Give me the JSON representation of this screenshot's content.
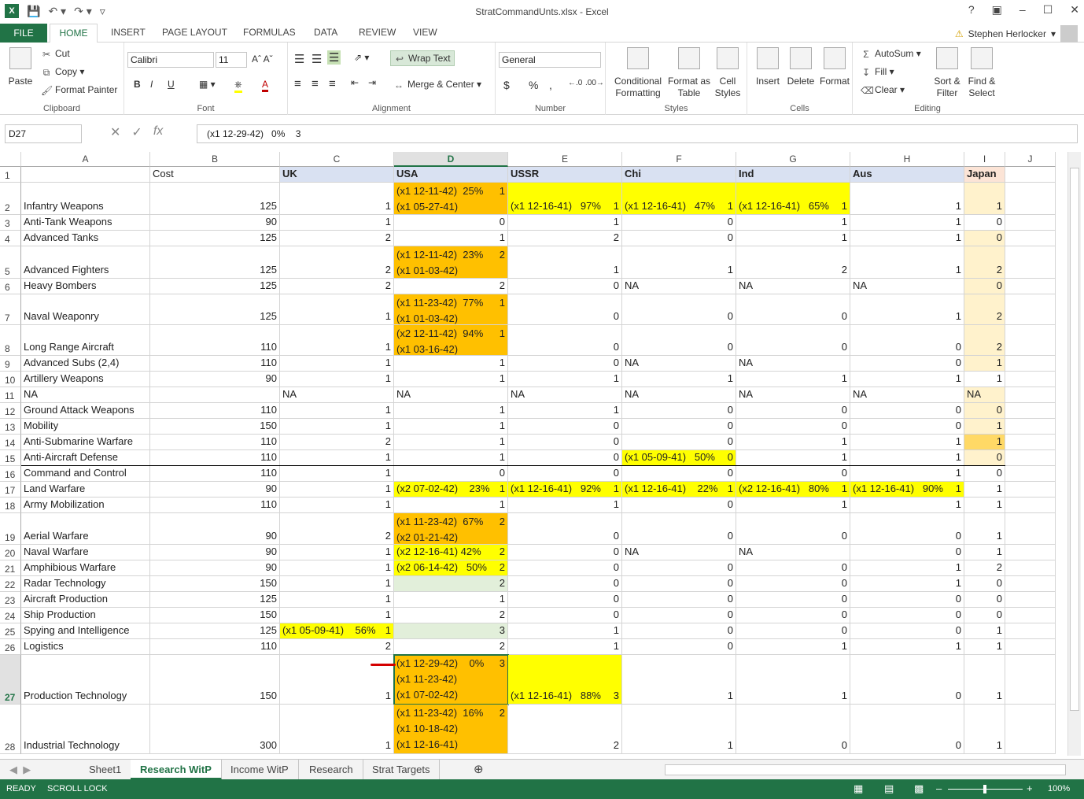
{
  "window": {
    "title": "StratCommandUnts.xlsx - Excel",
    "help": "?",
    "controls": [
      "restore-ribbon",
      "minimize",
      "maximize",
      "close"
    ]
  },
  "ribbon_tabs": [
    "FILE",
    "HOME",
    "INSERT",
    "PAGE LAYOUT",
    "FORMULAS",
    "DATA",
    "REVIEW",
    "VIEW"
  ],
  "user": {
    "name": "Stephen Herlocker"
  },
  "clipboard": {
    "paste": "Paste",
    "cut": "Cut",
    "copy": "Copy",
    "format_painter": "Format Painter",
    "label": "Clipboard"
  },
  "font": {
    "name": "Calibri",
    "size": "11",
    "label": "Font",
    "bold": "B",
    "italic": "I",
    "underline": "U"
  },
  "alignment": {
    "wrap_text": "Wrap Text",
    "merge_center": "Merge & Center",
    "label": "Alignment"
  },
  "number": {
    "format": "General",
    "currency": "$",
    "percent": "%",
    "comma": ",",
    "label": "Number"
  },
  "styles": {
    "conditional": [
      "Conditional",
      "Formatting"
    ],
    "format_table": [
      "Format as",
      "Table"
    ],
    "cell_styles": [
      "Cell",
      "Styles"
    ],
    "label": "Styles"
  },
  "cells": {
    "insert": "Insert",
    "delete": "Delete",
    "format": "Format",
    "label": "Cells"
  },
  "editing": {
    "autosum": "AutoSum",
    "fill": "Fill",
    "clear": "Clear",
    "sort": [
      "Sort &",
      "Filter"
    ],
    "find": [
      "Find &",
      "Select"
    ],
    "label": "Editing"
  },
  "formula_bar": {
    "name_box": "D27",
    "value": "(x1 12-29-42)   0%    3"
  },
  "columns": [
    "A",
    "B",
    "C",
    "D",
    "E",
    "F",
    "G",
    "H",
    "I",
    "J"
  ],
  "active_cell": "D27",
  "rows": [
    {
      "n": "1",
      "h": 20,
      "A": "",
      "B": "Cost",
      "C": "UK",
      "D": "USA",
      "E": "USSR",
      "F": "Chi",
      "G": "Ind",
      "H": "Aus",
      "I": "Japan",
      "J": ""
    },
    {
      "n": "2",
      "h": 41,
      "A": "Infantry Weapons",
      "B": "125",
      "C": "1",
      "D": [
        [
          "(x1 12-11-42)  25%",
          "1"
        ],
        [
          "(x1 05-27-41)",
          ""
        ]
      ],
      "E": [
        [
          "(x1 12-16-41)   97%",
          "1"
        ]
      ],
      "F": [
        [
          "(x1 12-16-41)   47%",
          "1"
        ]
      ],
      "G": [
        [
          "(x1 12-16-41)   65%",
          "1"
        ]
      ],
      "H": "1",
      "I": "1"
    },
    {
      "n": "3",
      "h": 20,
      "A": "Anti-Tank Weapons",
      "B": "90",
      "C": "1",
      "D": "0",
      "E": "1",
      "F": "0",
      "G": "1",
      "H": "1",
      "I": "0"
    },
    {
      "n": "4",
      "h": 20,
      "A": "Advanced Tanks",
      "B": "125",
      "C": "2",
      "D": "1",
      "E": "2",
      "F": "0",
      "G": "1",
      "H": "1",
      "I": "0"
    },
    {
      "n": "5",
      "h": 41,
      "A": "Advanced Fighters",
      "B": "125",
      "C": "2",
      "D": [
        [
          "(x1 12-11-42)  23%",
          "2"
        ],
        [
          "(x1 01-03-42)",
          ""
        ]
      ],
      "E": "1",
      "F": "1",
      "G": "2",
      "H": "1",
      "I": "2"
    },
    {
      "n": "6",
      "h": 20,
      "A": "Heavy Bombers",
      "B": "125",
      "C": "2",
      "D": "2",
      "E": "0",
      "F": "NA",
      "G": "NA",
      "H": "NA",
      "I": "0"
    },
    {
      "n": "7",
      "h": 39,
      "A": "Naval Weaponry",
      "B": "125",
      "C": "1",
      "D": [
        [
          "(x1 11-23-42)  77%",
          "1"
        ],
        [
          "(x1 01-03-42)",
          ""
        ]
      ],
      "E": "0",
      "F": "0",
      "G": "0",
      "H": "1",
      "I": "2"
    },
    {
      "n": "8",
      "h": 39,
      "A": "Long Range Aircraft",
      "B": "110",
      "C": "1",
      "D": [
        [
          "(x2 12-11-42)  94%",
          "1"
        ],
        [
          "(x1 03-16-42)",
          ""
        ]
      ],
      "E": "0",
      "F": "0",
      "G": "0",
      "H": "0",
      "I": "2"
    },
    {
      "n": "9",
      "h": 20,
      "A": "Advanced Subs (2,4)",
      "B": "110",
      "C": "1",
      "D": "1",
      "E": "0",
      "F": "NA",
      "G": "NA",
      "H": "0",
      "I": "1"
    },
    {
      "n": "10",
      "h": 20,
      "A": "Artillery Weapons",
      "B": "90",
      "C": "1",
      "D": "1",
      "E": "1",
      "F": "1",
      "G": "1",
      "H": "1",
      "I": "1"
    },
    {
      "n": "11",
      "h": 20,
      "A": "NA",
      "B": "",
      "C": "NA",
      "D": "NA",
      "E": "NA",
      "F": "NA",
      "G": "NA",
      "H": "NA",
      "I": "NA"
    },
    {
      "n": "12",
      "h": 20,
      "A": "Ground Attack Weapons",
      "B": "110",
      "C": "1",
      "D": "1",
      "E": "1",
      "F": "0",
      "G": "0",
      "H": "0",
      "I": "0"
    },
    {
      "n": "13",
      "h": 20,
      "A": "Mobility",
      "B": "150",
      "C": "1",
      "D": "1",
      "E": "0",
      "F": "0",
      "G": "0",
      "H": "0",
      "I": "1"
    },
    {
      "n": "14",
      "h": 20,
      "A": "Anti-Submarine Warfare",
      "B": "110",
      "C": "2",
      "D": "1",
      "E": "0",
      "F": "0",
      "G": "1",
      "H": "1",
      "I": "1"
    },
    {
      "n": "15",
      "h": 20,
      "A": "Anti-Aircraft Defense",
      "B": "110",
      "C": "1",
      "D": "1",
      "E": "0",
      "F": [
        [
          "(x1 05-09-41)   50%",
          "0"
        ]
      ],
      "G": "1",
      "H": "1",
      "I": "0"
    },
    {
      "n": "16",
      "h": 20,
      "A": "Command and Control",
      "B": "110",
      "C": "1",
      "D": "0",
      "E": "0",
      "F": "0",
      "G": "0",
      "H": "1",
      "I": "0"
    },
    {
      "n": "17",
      "h": 20,
      "A": "Land Warfare",
      "B": "90",
      "C": "1",
      "D": [
        [
          "(x2 07-02-42)    23%",
          "1"
        ]
      ],
      "E": [
        [
          "(x1 12-16-41)   92%",
          "1"
        ]
      ],
      "F": [
        [
          "(x1 12-16-41)    22%",
          "1"
        ]
      ],
      "G": [
        [
          "(x2 12-16-41)   80%",
          "1"
        ]
      ],
      "H": [
        [
          "(x1 12-16-41)   90%",
          "1"
        ]
      ],
      "I": "1"
    },
    {
      "n": "18",
      "h": 20,
      "A": "Army Mobilization",
      "B": "110",
      "C": "1",
      "D": "1",
      "E": "1",
      "F": "0",
      "G": "1",
      "H": "1",
      "I": "1"
    },
    {
      "n": "19",
      "h": 40,
      "A": "Aerial Warfare",
      "B": "90",
      "C": "2",
      "D": [
        [
          "(x1 11-23-42)  67%",
          "2"
        ],
        [
          "(x2 01-21-42)",
          ""
        ]
      ],
      "E": "0",
      "F": "0",
      "G": "0",
      "H": "0",
      "I": "1"
    },
    {
      "n": "20",
      "h": 20,
      "A": "Naval Warfare",
      "B": "90",
      "C": "1",
      "D": [
        [
          "(x2 12-16-41) 42%",
          "2"
        ]
      ],
      "E": "0",
      "F": "NA",
      "G": "NA",
      "H": "0",
      "I": "1"
    },
    {
      "n": "21",
      "h": 20,
      "A": "Amphibious Warfare",
      "B": "90",
      "C": "1",
      "D": [
        [
          "(x2 06-14-42)   50%",
          "2"
        ]
      ],
      "E": "0",
      "F": "0",
      "G": "0",
      "H": "1",
      "I": "2"
    },
    {
      "n": "22",
      "h": 20,
      "A": "Radar Technology",
      "B": "150",
      "C": "1",
      "D": "2",
      "E": "0",
      "F": "0",
      "G": "0",
      "H": "1",
      "I": "0"
    },
    {
      "n": "23",
      "h": 20,
      "A": "Aircraft Production",
      "B": "125",
      "C": "1",
      "D": "1",
      "E": "0",
      "F": "0",
      "G": "0",
      "H": "0",
      "I": "0"
    },
    {
      "n": "24",
      "h": 20,
      "A": "Ship Production",
      "B": "150",
      "C": "1",
      "D": "2",
      "E": "0",
      "F": "0",
      "G": "0",
      "H": "0",
      "I": "0"
    },
    {
      "n": "25",
      "h": 20,
      "A": "Spying and Intelligence",
      "B": "125",
      "C": [
        [
          "(x1 05-09-41)    56%",
          "1"
        ]
      ],
      "D": "3",
      "E": "1",
      "F": "0",
      "G": "0",
      "H": "0",
      "I": "1"
    },
    {
      "n": "26",
      "h": 20,
      "A": "Logistics",
      "B": "110",
      "C": "2",
      "D": "2",
      "E": "1",
      "F": "0",
      "G": "1",
      "H": "1",
      "I": "1"
    },
    {
      "n": "27",
      "h": 63,
      "A": "Production Technology",
      "B": "150",
      "C": "1",
      "D": [
        [
          "(x1 12-29-42)    0%",
          "3"
        ],
        [
          "(x1 11-23-42)",
          ""
        ],
        [
          "(x1 07-02-42)",
          ""
        ]
      ],
      "E": [
        [
          "(x1 12-16-41)   88%",
          "3"
        ]
      ],
      "F": "1",
      "G": "1",
      "H": "0",
      "I": "1"
    },
    {
      "n": "28",
      "h": 63,
      "A": "Industrial Technology",
      "B": "300",
      "C": "1",
      "D": [
        [
          "(x1 11-23-42)  16%",
          "2"
        ],
        [
          "(x1 10-18-42)",
          ""
        ],
        [
          "(x1 12-16-41)",
          ""
        ]
      ],
      "E": "2",
      "F": "1",
      "G": "0",
      "H": "0",
      "I": "1"
    }
  ],
  "fills": {
    "1": {
      "C": "hdrblue",
      "D": "hdrblue",
      "E": "hdrblue",
      "F": "hdrblue",
      "G": "hdrblue",
      "H": "hdrblue",
      "I": "hdrpeach"
    },
    "2": {
      "D": "orange",
      "E": "yellow",
      "F": "yellow",
      "G": "yellow",
      "I": "peach"
    },
    "4": {
      "I": "peach"
    },
    "5": {
      "D": "orange",
      "I": "peach"
    },
    "6": {
      "I": "peach"
    },
    "7": {
      "D": "orange",
      "I": "peach"
    },
    "8": {
      "D": "orange",
      "I": "peach"
    },
    "9": {
      "I": "peach"
    },
    "11": {
      "I": "peach"
    },
    "12": {
      "I": "peach"
    },
    "13": {
      "I": "peach"
    },
    "14": {
      "I": "gold"
    },
    "15": {
      "F": "yellow",
      "I": "peach"
    },
    "17": {
      "D": "yellow",
      "E": "yellow",
      "F": "yellow",
      "G": "yellow",
      "H": "yellow"
    },
    "19": {
      "D": "orange"
    },
    "20": {
      "D": "yellow"
    },
    "21": {
      "D": "yellow"
    },
    "22": {
      "D": "lightgreen"
    },
    "25": {
      "C": "yellow",
      "D": "lightgreen"
    },
    "27": {
      "D": "orange",
      "E": "yellow"
    },
    "28": {
      "D": "orange"
    }
  },
  "sheet_tabs": [
    "Sheet1",
    "Research WitP",
    "Income WitP",
    "Research",
    "Strat Targets"
  ],
  "active_sheet": "Research WitP",
  "status": {
    "ready": "READY",
    "scroll_lock": "SCROLL LOCK",
    "zoom": "100%"
  },
  "colors": {
    "excel_green": "#217346",
    "orange": "#ffc000",
    "yellow": "#ffff00"
  }
}
